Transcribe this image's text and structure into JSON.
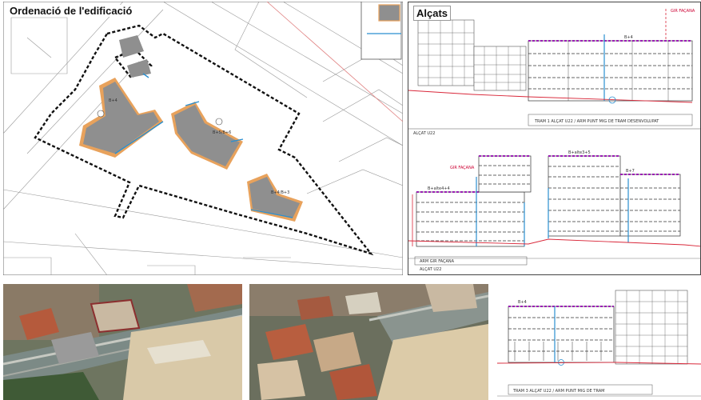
{
  "plan": {
    "title": "Ordenació de l'edificació",
    "block_labels": [
      "B+4",
      "B+5/B+6",
      "B+4/B+3"
    ]
  },
  "elevations": {
    "title": "Alçats",
    "top": {
      "facade_label": "GIR FAÇANA",
      "height_label": "B+4",
      "caption": "TRAM 1 ALÇAT U22 / ARM PUNT MIG DE TRAM DESENVOLUPAT",
      "sublabel": "ALÇAT U22"
    },
    "middle": {
      "facade_label": "GIR FAÇANA",
      "left_height": "B+alte4+4",
      "center_height": "B+alte3+5",
      "right_height": "B+7",
      "caption": "ARM GIR FAÇANA",
      "sublabel": "ALÇAT U22"
    },
    "bottom": {
      "height_label": "B+4",
      "caption": "TRAM 3 ALÇAT U22 / ARM PUNT MIG DE TRAM"
    }
  },
  "colors": {
    "boundary": "#111111",
    "building_grey": "#8f8f8f",
    "setback_orange": "#e8a25c",
    "accent_blue": "#2a8fd0",
    "profile_purple": "#9b1fb5",
    "ground_red": "#d9283a"
  }
}
